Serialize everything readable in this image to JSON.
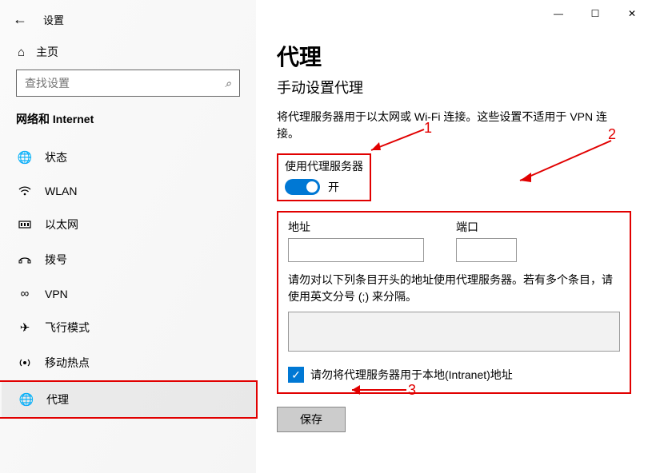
{
  "window": {
    "title": "设置",
    "home": "主页",
    "search_placeholder": "查找设置",
    "category": "网络和 Internet"
  },
  "nav": {
    "items": [
      {
        "icon": "status",
        "label": "状态"
      },
      {
        "icon": "wifi",
        "label": "WLAN"
      },
      {
        "icon": "ethernet",
        "label": "以太网"
      },
      {
        "icon": "dialup",
        "label": "拨号"
      },
      {
        "icon": "vpn",
        "label": "VPN"
      },
      {
        "icon": "airplane",
        "label": "飞行模式"
      },
      {
        "icon": "hotspot",
        "label": "移动热点"
      },
      {
        "icon": "proxy",
        "label": "代理"
      }
    ]
  },
  "main": {
    "title": "代理",
    "subtitle": "手动设置代理",
    "description": "将代理服务器用于以太网或 Wi-Fi 连接。这些设置不适用于 VPN 连接。",
    "toggle": {
      "label": "使用代理服务器",
      "state_label": "开",
      "on": true
    },
    "address_label": "地址",
    "address_value": "",
    "port_label": "端口",
    "port_value": "",
    "bypass_note": "请勿对以下列条目开头的地址使用代理服务器。若有多个条目，请使用英文分号 (;) 来分隔。",
    "bypass_value": "",
    "intranet_checkbox_label": "请勿将代理服务器用于本地(Intranet)地址",
    "intranet_checked": true,
    "save_label": "保存"
  },
  "annotations": {
    "n1": "1",
    "n2": "2",
    "n3": "3"
  }
}
